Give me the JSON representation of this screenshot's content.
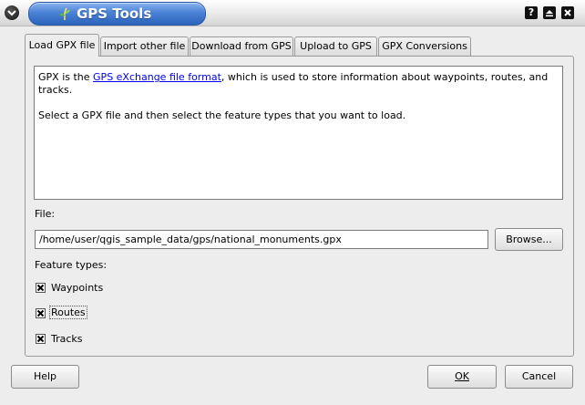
{
  "window": {
    "title": "GPS Tools",
    "accent": "#3a73cc"
  },
  "tabs": [
    {
      "label": "Load GPX file",
      "active": true
    },
    {
      "label": "Import other file",
      "active": false
    },
    {
      "label": "Download from GPS",
      "active": false
    },
    {
      "label": "Upload to GPS",
      "active": false
    },
    {
      "label": "GPX Conversions",
      "active": false
    }
  ],
  "info": {
    "line1_prefix": "GPX is the ",
    "link_text": "GPS eXchange file format",
    "line1_suffix": ", which is used to store information about waypoints, routes, and tracks.",
    "line2": "Select a GPX file and then select the feature types that you want to load."
  },
  "file": {
    "label": "File:",
    "value": "/home/user/qgis_sample_data/gps/national_monuments.gpx",
    "browse_label": "Browse..."
  },
  "features": {
    "label": "Feature types:",
    "items": [
      {
        "label": "Waypoints",
        "checked": true
      },
      {
        "label": "Routes",
        "checked": true
      },
      {
        "label": "Tracks",
        "checked": true
      }
    ]
  },
  "buttons": {
    "help": "Help",
    "ok": "OK",
    "cancel": "Cancel"
  },
  "icons": {
    "menu": "chevron-down-icon",
    "title": "gps-plant-icon",
    "help": "question-icon",
    "shade": "shade-icon",
    "close": "close-icon",
    "check": "x-check-icon"
  }
}
